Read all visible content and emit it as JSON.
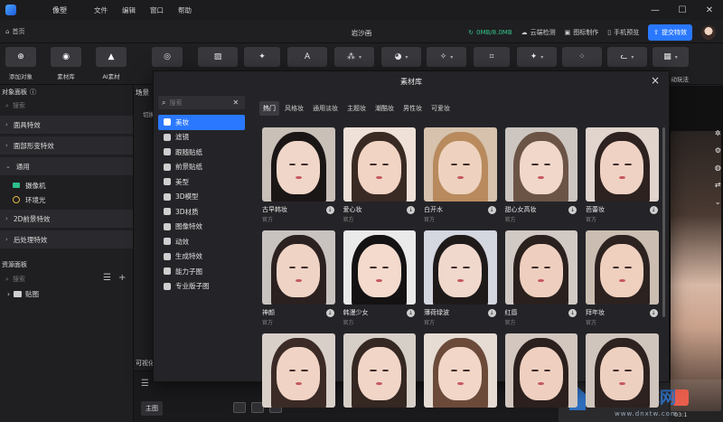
{
  "app": {
    "name": "像塑"
  },
  "menu": [
    "文件",
    "编辑",
    "窗口",
    "帮助"
  ],
  "window": {
    "minimize": "—",
    "maximize": "☐",
    "close": "✕"
  },
  "subbar": {
    "home": "首页",
    "project_title": "岩沙画",
    "memory": "0MB/8.0MB",
    "links": [
      "云端检测",
      "图标制作",
      "手机预览"
    ],
    "submit": "提交特效"
  },
  "toolbar": {
    "add_object": "添加对象",
    "library": "素材库",
    "ai_material": "AI素材",
    "right_label": "动玩法"
  },
  "left_panel": {
    "title": "对象面板",
    "search_placeholder": "搜索",
    "groups": [
      "面具特效",
      "面部形变特效"
    ],
    "common_group": "通用",
    "common_items": [
      "摄像机",
      "环境光"
    ],
    "groups2": [
      "2D前景特效",
      "后处理特效"
    ],
    "resource_title": "资源面板",
    "resource_search": "搜索",
    "folder": "贴图"
  },
  "scene": {
    "tab": "场景",
    "switch_label": "切换",
    "viewer_label": "可视化",
    "main_tag": "主图"
  },
  "watermark": {
    "text": "电脑系统网",
    "url": "www.dnxtw.com"
  },
  "preview": {
    "clock": "03:1"
  },
  "modal": {
    "title": "素材库",
    "search_placeholder": "搜索",
    "categories": [
      "美妆",
      "滤镜",
      "跟随贴纸",
      "前景贴纸",
      "美型",
      "3D模型",
      "3D材质",
      "图像特效",
      "动效",
      "生成特效",
      "能力子图",
      "专业版子图"
    ],
    "active_category": "美妆",
    "tabs": [
      "热门",
      "风格妆",
      "通用淡妆",
      "主题妆",
      "潮酷妆",
      "男性妆",
      "可爱妆"
    ],
    "active_tab": "热门",
    "items": [
      {
        "name": "古早韩妆",
        "source": "官方",
        "bg": "#c9c0b8",
        "skin": "#f0d6c8",
        "hair": "#1b1616"
      },
      {
        "name": "爱心妆",
        "source": "官方",
        "bg": "#efe1d8",
        "skin": "#f2d4c4",
        "hair": "#3a2a24"
      },
      {
        "name": "白开水",
        "source": "官方",
        "bg": "#d6c2ad",
        "skin": "#eed2bf",
        "hair": "#b88a5e"
      },
      {
        "name": "甜心女高妆",
        "source": "官方",
        "bg": "#cdc6c0",
        "skin": "#f1d7c9",
        "hair": "#6b5446"
      },
      {
        "name": "芭蕾妆",
        "source": "官方",
        "bg": "#e0d4cc",
        "skin": "#f0d2c4",
        "hair": "#2d2220"
      },
      {
        "name": "神颜",
        "source": "官方",
        "bg": "#c9c3c0",
        "skin": "#efd3c5",
        "hair": "#2b2120"
      },
      {
        "name": "韩漫少女",
        "source": "官方",
        "bg": "#eaeaea",
        "skin": "#f3dacd",
        "hair": "#141213"
      },
      {
        "name": "薄荷绿波",
        "source": "官方",
        "bg": "#d4d6e0",
        "skin": "#f1d8cc",
        "hair": "#1f1a1a"
      },
      {
        "name": "红唇",
        "source": "官方",
        "bg": "#d1c9c4",
        "skin": "#eecfbf",
        "hair": "#2a201d"
      },
      {
        "name": "拜年妆",
        "source": "官方",
        "bg": "#cbbdb2",
        "skin": "#efcfbe",
        "hair": "#2c2220"
      },
      {
        "name": "",
        "source": "",
        "bg": "#d9cfc9",
        "skin": "#f0d3c4",
        "hair": "#3b2a25"
      },
      {
        "name": "",
        "source": "",
        "bg": "#d6cfc8",
        "skin": "#f1d6c8",
        "hair": "#352722"
      },
      {
        "name": "",
        "source": "",
        "bg": "#e6dcd4",
        "skin": "#f2d6c8",
        "hair": "#6b4a3a"
      },
      {
        "name": "",
        "source": "",
        "bg": "#d2c6bf",
        "skin": "#efd0c0",
        "hair": "#2b201d"
      },
      {
        "name": "",
        "source": "",
        "bg": "#d0c5bd",
        "skin": "#eed0c0",
        "hair": "#2d221f"
      }
    ]
  }
}
